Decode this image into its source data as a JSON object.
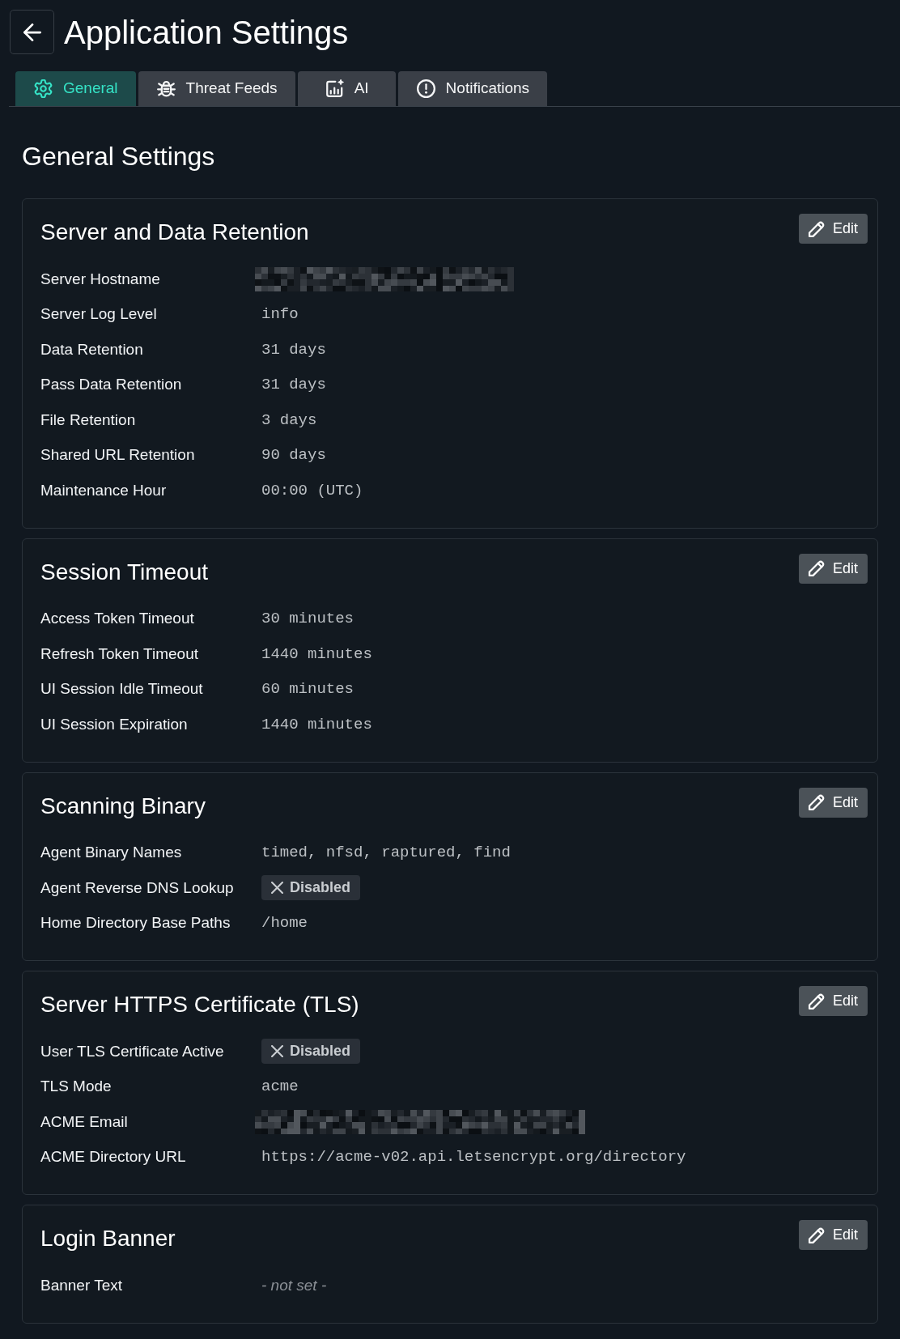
{
  "page": {
    "title": "Application Settings"
  },
  "tabs": [
    {
      "label": "General",
      "selected": true
    },
    {
      "label": "Threat Feeds",
      "selected": false
    },
    {
      "label": "AI",
      "selected": false
    },
    {
      "label": "Notifications",
      "selected": false
    }
  ],
  "section_title": "General Settings",
  "cards": [
    {
      "title": "Server and Data Retention",
      "edit_button": "Edit",
      "rows": [
        {
          "label": "Server Hostname",
          "kind": "redacted"
        },
        {
          "label": "Server Log Level",
          "kind": "text",
          "value": "info"
        },
        {
          "label": "Data Retention",
          "kind": "text",
          "value": "31 days"
        },
        {
          "label": "Pass Data Retention",
          "kind": "text",
          "value": "31 days"
        },
        {
          "label": "File Retention",
          "kind": "text",
          "value": "3 days"
        },
        {
          "label": "Shared URL Retention",
          "kind": "text",
          "value": "90 days"
        },
        {
          "label": "Maintenance Hour",
          "kind": "text",
          "value": "00:00 (UTC)"
        }
      ]
    },
    {
      "title": "Session Timeout",
      "edit_button": "Edit",
      "rows": [
        {
          "label": "Access Token Timeout",
          "kind": "text",
          "value": "30 minutes"
        },
        {
          "label": "Refresh Token Timeout",
          "kind": "text",
          "value": "1440 minutes"
        },
        {
          "label": "UI Session Idle Timeout",
          "kind": "text",
          "value": "60 minutes"
        },
        {
          "label": "UI Session Expiration",
          "kind": "text",
          "value": "1440 minutes"
        }
      ]
    },
    {
      "title": "Scanning Binary",
      "edit_button": "Edit",
      "rows": [
        {
          "label": "Agent Binary Names",
          "kind": "text",
          "value": "timed, nfsd, raptured, find"
        },
        {
          "label": "Agent Reverse DNS Lookup",
          "kind": "badge",
          "value": "Disabled",
          "on": false
        },
        {
          "label": "Home Directory Base Paths",
          "kind": "text",
          "value": "/home"
        }
      ]
    },
    {
      "title": "Server HTTPS Certificate (TLS)",
      "edit_button": "Edit",
      "rows": [
        {
          "label": "User TLS Certificate Active",
          "kind": "badge",
          "value": "Disabled",
          "on": false
        },
        {
          "label": "TLS Mode",
          "kind": "text",
          "value": "acme"
        },
        {
          "label": "ACME Email",
          "kind": "redacted"
        },
        {
          "label": "ACME Directory URL",
          "kind": "text",
          "value": "https://acme-v02.api.letsencrypt.org/directory"
        }
      ]
    },
    {
      "title": "Login Banner",
      "edit_button": "Edit",
      "rows": [
        {
          "label": "Banner Text",
          "kind": "placeholder",
          "value": "- not set -"
        }
      ]
    }
  ]
}
